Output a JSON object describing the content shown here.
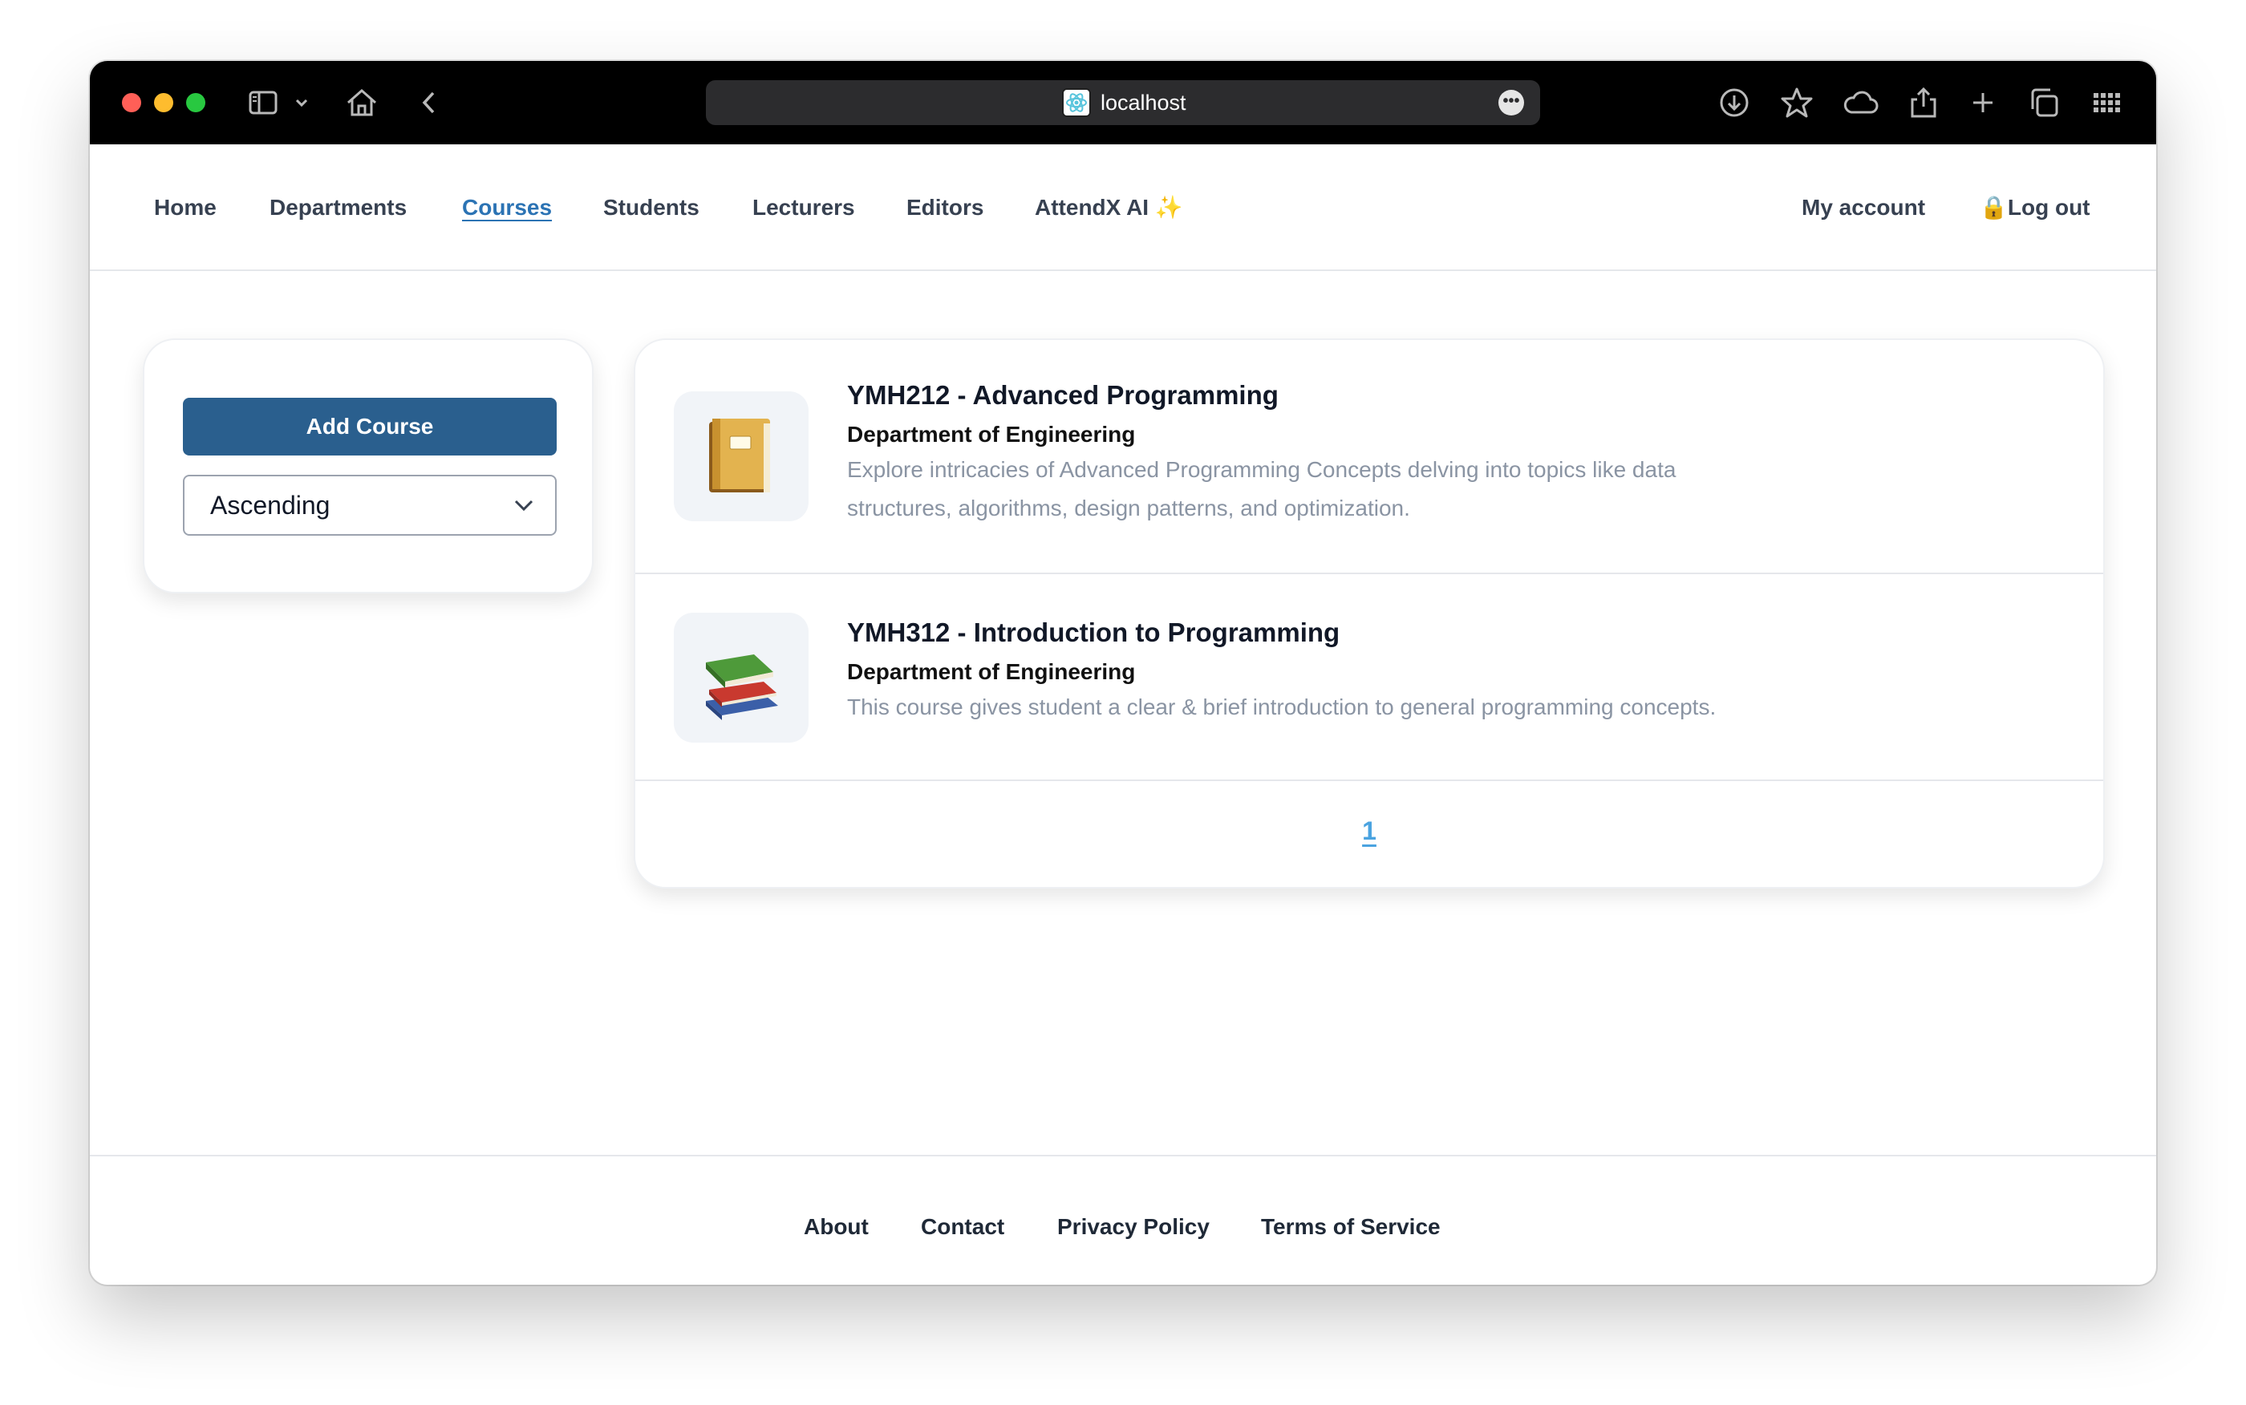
{
  "browser": {
    "url": "localhost",
    "icons": [
      "sidebar-icon",
      "chevron-down-icon",
      "home-icon",
      "back-icon",
      "download-icon",
      "star-icon",
      "cloud-icon",
      "share-icon",
      "plus-icon",
      "tabs-icon",
      "grid-icon"
    ]
  },
  "nav": {
    "home": "Home",
    "departments": "Departments",
    "courses": "Courses",
    "students": "Students",
    "lecturers": "Lecturers",
    "editors": "Editors",
    "attendx": "AttendX AI",
    "sparkle": "✨",
    "my_account": "My account",
    "lock": "🔒",
    "logout": "Log out",
    "active": "Courses"
  },
  "sidebar": {
    "add_course": "Add Course",
    "sort_value": "Ascending"
  },
  "courses": [
    {
      "emoji": "📔",
      "title": "YMH212 - Advanced Programming",
      "department": "Department of Engineering",
      "description": "Explore intricacies of Advanced Programming Concepts delving into topics like data structures, algorithms, design patterns, and optimization."
    },
    {
      "emoji": "📚",
      "title": "YMH312 - Introduction to Programming",
      "department": "Department of Engineering",
      "description": "This course gives student a clear & brief introduction to general programming concepts."
    }
  ],
  "pagination": {
    "current": "1"
  },
  "footer": {
    "about": "About",
    "contact": "Contact",
    "privacy": "Privacy Policy",
    "terms": "Terms of Service"
  },
  "colors": {
    "primary_button": "#2a5f8e",
    "active_link": "#2b73b4",
    "page_link": "#4aa3e0"
  }
}
